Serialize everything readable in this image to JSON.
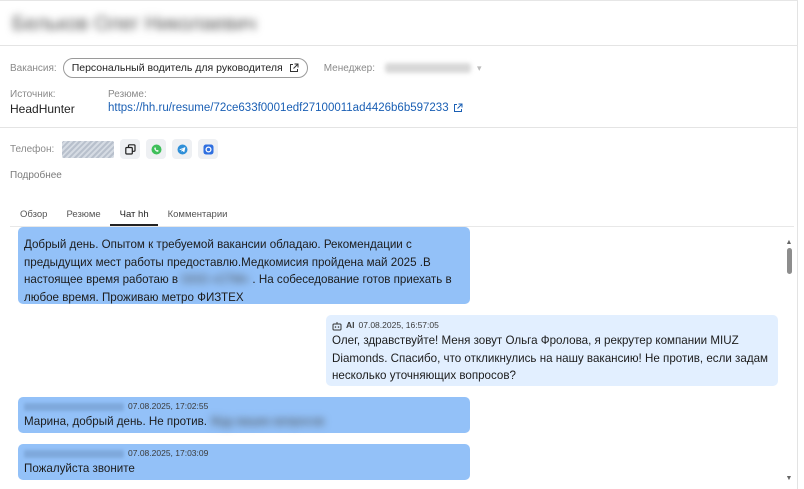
{
  "candidate": {
    "name": "Бельков Олег Николаевич"
  },
  "vacancy": {
    "label": "Вакансия:",
    "value": "Персональный водитель для руководителя"
  },
  "manager": {
    "label": "Менеджер:",
    "value": "Ольга Фролова"
  },
  "source": {
    "label": "Источник:",
    "value": "HeadHunter"
  },
  "resume": {
    "label": "Резюме:",
    "url": "https://hh.ru/resume/72ce633f0001edf27100011ad4426b6b597233"
  },
  "phone": {
    "label": "Телефон:",
    "actions": [
      "copy-icon",
      "whatsapp-icon",
      "telegram-icon",
      "max-icon"
    ]
  },
  "more_label": "Подробнее",
  "tabs": [
    {
      "label": "Обзор",
      "active": false
    },
    {
      "label": "Резюме",
      "active": false
    },
    {
      "label": "Чат hh",
      "active": true
    },
    {
      "label": "Комментарии",
      "active": false
    }
  ],
  "chat": {
    "messages": [
      {
        "direction": "in",
        "sender": "",
        "timestamp": "",
        "text_lines": [
          "Добрый день. Опытом к требуемой вакансии обладаю. Рекомендации с",
          "предыдущих мест работы  предоставлю.Медкомисия пройдена май 2025 .В",
          "настоящее  время работаю в",
          ". На собеседование готов приехать  в",
          "любое время. Проживаю метро ФИЗТЕХ"
        ],
        "hidden_text": "ООО «СТМ»"
      },
      {
        "direction": "out",
        "ai_label": "AI",
        "timestamp": "07.08.2025, 16:57:05",
        "text_lines": [
          "Олег, здравствуйте! Меня зовут Ольга Фролова, я рекрутер компании MIUZ",
          "Diamonds. Спасибо, что откликнулись на нашу вакансию! Не против, если задам",
          "несколько уточняющих вопросов?"
        ]
      },
      {
        "direction": "in",
        "sender": "Бельков Олег Николаевич",
        "timestamp": "07.08.2025, 17:02:55",
        "text": "Марина, добрый день. Не против.",
        "hidden_text": "Жду ваших вопросов"
      },
      {
        "direction": "in",
        "sender": "Бельков Олег Николаевич",
        "timestamp": "07.08.2025, 17:03:09",
        "text": "Пожалуйста звоните"
      }
    ]
  },
  "colors": {
    "incoming_bubble": "#93c1f8",
    "outgoing_bubble": "#e2efff",
    "link": "#1a5fb4"
  }
}
